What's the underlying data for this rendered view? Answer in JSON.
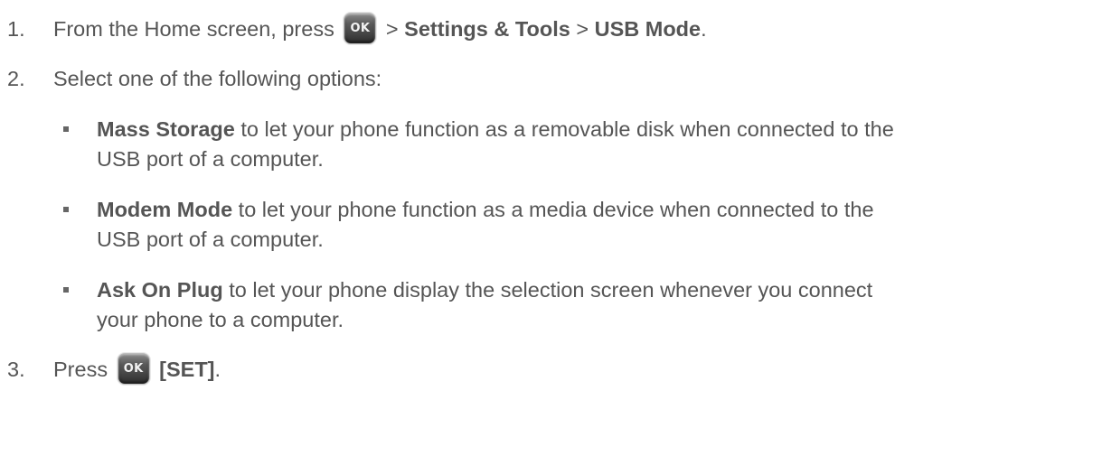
{
  "ok_key_label": "OK",
  "steps": [
    {
      "number": "1.",
      "text_before": "From the Home screen, press",
      "sep1": ">",
      "bold1": "Settings & Tools",
      "sep2": ">",
      "bold2": "USB Mode",
      "end": "."
    },
    {
      "number": "2.",
      "text": "Select one of the following options:",
      "options": [
        {
          "bold": "Mass Storage",
          "line1": " to let your phone function as a removable disk when connected to the",
          "line2": "USB port of a computer."
        },
        {
          "bold": "Modem Mode",
          "line1": " to let your phone function as a media device when connected to the",
          "line2": "USB port of a computer."
        },
        {
          "bold": "Ask On Plug",
          "line1": " to let your phone display the selection screen whenever you connect",
          "line2": "your phone to a computer."
        }
      ]
    },
    {
      "number": "3.",
      "text_before": "Press",
      "bold": "[SET]",
      "end": "."
    }
  ]
}
